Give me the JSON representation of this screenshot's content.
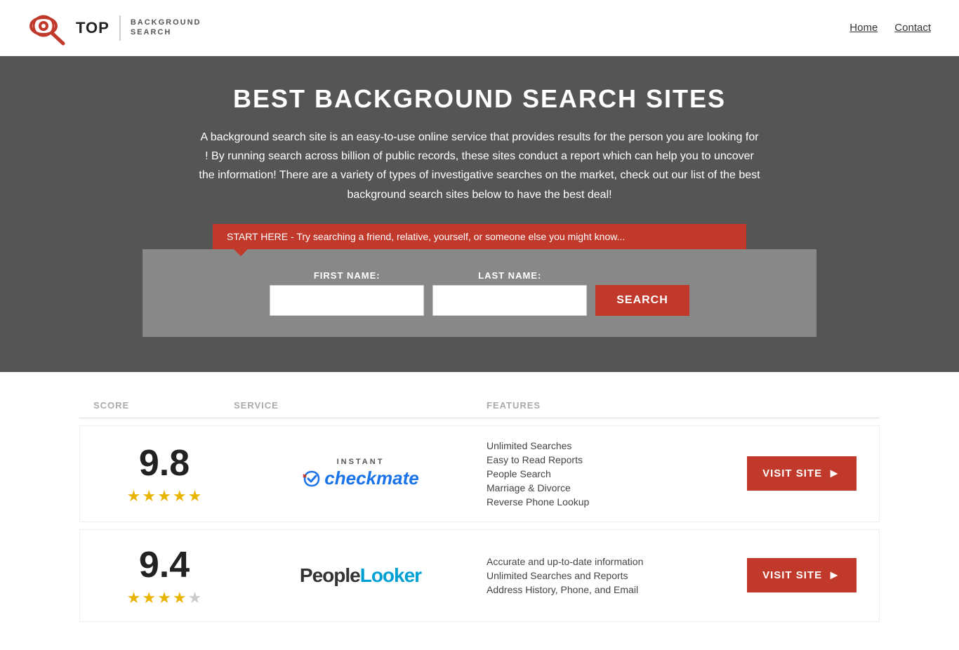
{
  "header": {
    "logo_top": "TOP",
    "logo_bg": "BACKGROUND",
    "logo_search": "SEARCH",
    "nav": [
      {
        "label": "Home",
        "href": "#"
      },
      {
        "label": "Contact",
        "href": "#"
      }
    ]
  },
  "hero": {
    "title": "BEST BACKGROUND SEARCH SITES",
    "description": "A background search site is an easy-to-use online service that provides results  for the person you are looking for ! By  running  search across billion of public records, these sites conduct  a report which can help you to uncover the information! There are a variety of types of investigative searches on the market, check out our  list of the best background search sites below to have the best deal!",
    "banner_text": "START HERE - Try searching a friend, relative, yourself, or someone else you might know...",
    "first_name_label": "FIRST NAME:",
    "last_name_label": "LAST NAME:",
    "search_button": "SEARCH"
  },
  "table": {
    "headers": {
      "score": "SCORE",
      "service": "SERVICE",
      "features": "FEATURES",
      "action": ""
    },
    "rows": [
      {
        "score": "9.8",
        "stars": 4.5,
        "service_name": "Instant Checkmate",
        "service_type": "checkmate",
        "features": [
          "Unlimited Searches",
          "Easy to Read Reports",
          "People Search",
          "Marriage & Divorce",
          "Reverse Phone Lookup"
        ],
        "visit_label": "VISIT SITE"
      },
      {
        "score": "9.4",
        "stars": 4,
        "service_name": "PeopleLooker",
        "service_type": "peoplelooker",
        "features": [
          "Accurate and up-to-date information",
          "Unlimited Searches and Reports",
          "Address History, Phone, and Email"
        ],
        "visit_label": "VISIT SITE"
      }
    ]
  }
}
